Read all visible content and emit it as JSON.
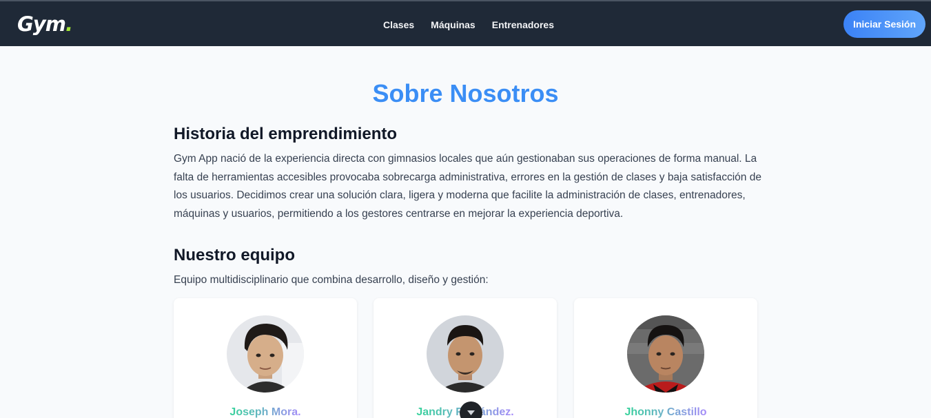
{
  "navbar": {
    "logo_text": "Gym",
    "logo_dot": ".",
    "links": [
      {
        "label": "Clases"
      },
      {
        "label": "Máquinas"
      },
      {
        "label": "Entrenadores"
      }
    ],
    "login_label": "Iniciar Sesión"
  },
  "main": {
    "title": "Sobre Nosotros",
    "history": {
      "heading": "Historia del emprendimiento",
      "body": "Gym App nació de la experiencia directa con gimnasios locales que aún gestionaban sus operaciones de forma manual. La falta de herramientas accesibles provocaba sobrecarga administrativa, errores en la gestión de clases y baja satisfacción de los usuarios. Decidimos crear una solución clara, ligera y moderna que facilite la administración de clases, entrenadores, máquinas y usuarios, permitiendo a los gestores centrarse en mejorar la experiencia deportiva."
    },
    "team": {
      "heading": "Nuestro equipo",
      "subtitle": "Equipo multidisciplinario que combina desarrollo, diseño y gestión:",
      "members": [
        {
          "name": "Joseph Mora."
        },
        {
          "name": "Jandry Fernández."
        },
        {
          "name": "Jhonny Castillo"
        }
      ]
    }
  },
  "scroll_button": {
    "icon": "chevron-down-icon"
  },
  "colors": {
    "navbar_bg": "#1f2937",
    "accent_blue": "#3b82f6",
    "title_blue": "#3b8ef5",
    "logo_dot": "#a3e635",
    "name_gradient_start": "#34d399",
    "name_gradient_end": "#a78bfa"
  }
}
